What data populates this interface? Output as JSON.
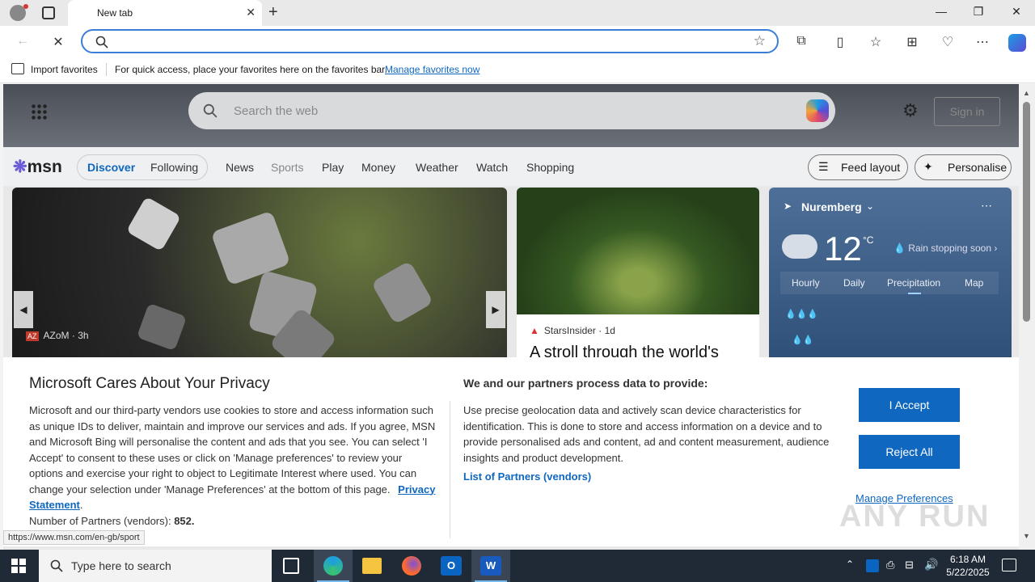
{
  "browser": {
    "tab_title": "New tab",
    "favorites_bar": {
      "import_label": "Import favorites",
      "hint": "For quick access, place your favorites here on the favorites bar.",
      "manage_link": "Manage favorites now"
    },
    "status_url": "https://www.msn.com/en-gb/sport"
  },
  "msn": {
    "search_placeholder": "Search the web",
    "sign_in": "Sign in",
    "logo": "msn",
    "feed_tabs": [
      "Discover",
      "Following"
    ],
    "nav": [
      "News",
      "Sports",
      "Play",
      "Money",
      "Weather",
      "Watch",
      "Shopping"
    ],
    "feed_layout": "Feed layout",
    "personalise": "Personalise",
    "hero": {
      "source": "AZoM",
      "age": "3h",
      "source_abbr": "AZ"
    },
    "card2": {
      "source": "StarsInsider",
      "age": "1d",
      "title": "A stroll through the world's"
    },
    "weather": {
      "city": "Nuremberg",
      "temp": "12",
      "unit": "°C",
      "note": "Rain stopping soon",
      "tabs": [
        "Hourly",
        "Daily",
        "Precipitation",
        "Map"
      ]
    }
  },
  "privacy": {
    "title": "Microsoft Cares About Your Privacy",
    "body": "Microsoft and our third-party vendors use cookies to store and access information such as unique IDs to deliver, maintain and improve our services and ads. If you agree, MSN and Microsoft Bing will personalise the content and ads that you see. You can select 'I Accept' to consent to these uses or click on 'Manage preferences' to review your options and exercise your right to object to Legitimate Interest where used.  You can change your selection under 'Manage Preferences' at the bottom of this page.",
    "privacy_link": "Privacy Statement",
    "partners_label": "Number of Partners (vendors):",
    "partners_count": "852.",
    "right_title": "We and our partners process data to provide:",
    "right_body": "Use precise geolocation data and actively scan device characteristics for identification. This is done to store and access information on a device and to provide personalised ads and content, ad and content measurement, audience insights and product development.",
    "partners_link": "List of Partners (vendors)",
    "accept": "I Accept",
    "reject": "Reject All",
    "manage": "Manage Preferences"
  },
  "taskbar": {
    "search_placeholder": "Type here to search",
    "time": "6:18 AM",
    "date": "5/22/2025"
  },
  "watermark": "ANY RUN",
  "colors": {
    "accent": "#0f67c0",
    "link": "#0f67c0",
    "omnibox_border": "#3b7ed8"
  }
}
